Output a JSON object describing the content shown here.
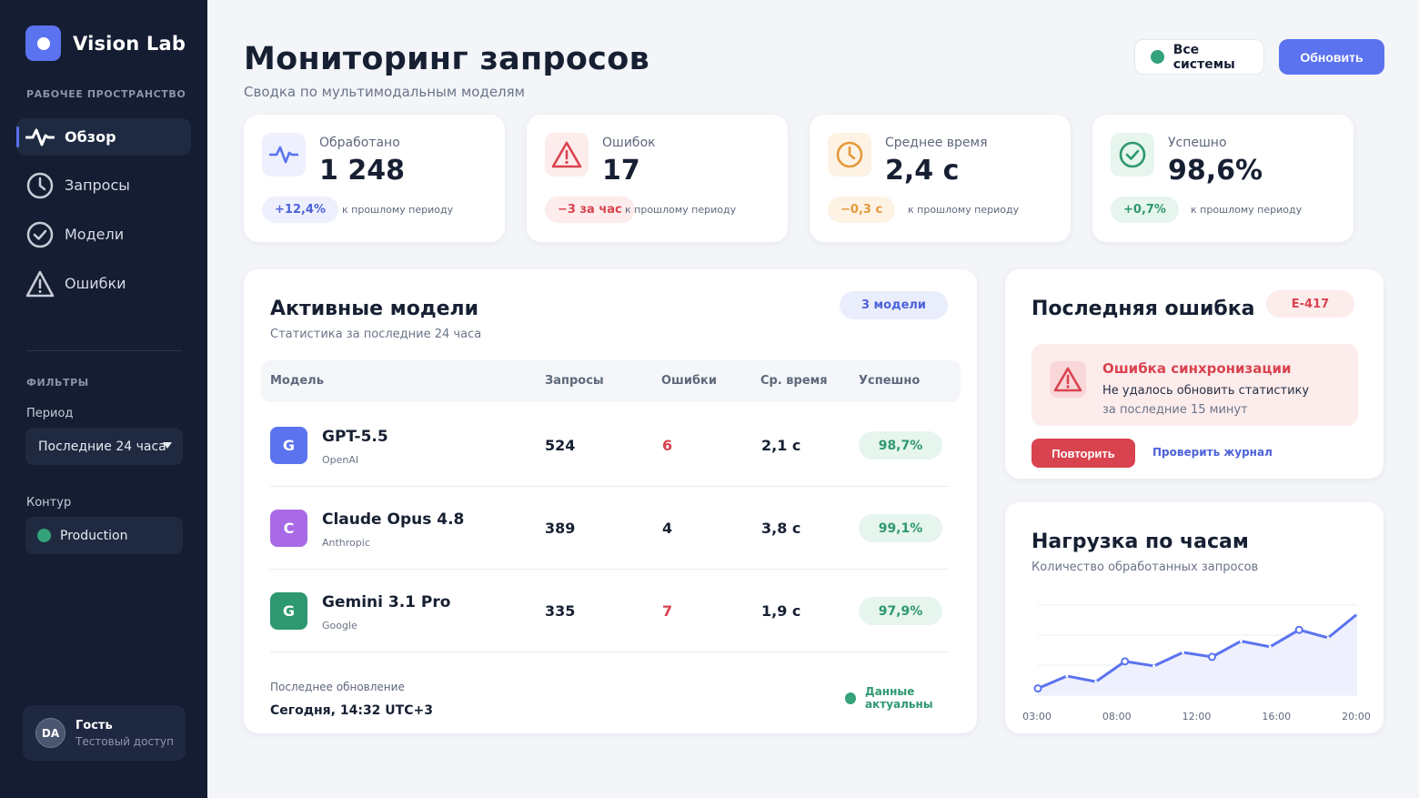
{
  "sidebar": {
    "brand": "Vision Lab",
    "workspace_title": "РАБОЧЕЕ ПРОСТРАНСТВО",
    "nav": [
      {
        "label": "Обзор",
        "icon": "activity-icon",
        "active": true
      },
      {
        "label": "Запросы",
        "icon": "clock-icon",
        "active": false
      },
      {
        "label": "Модели",
        "icon": "check-circle-icon",
        "active": false
      },
      {
        "label": "Ошибки",
        "icon": "warning-icon",
        "active": false
      }
    ],
    "filters_title": "ФИЛЬТРЫ",
    "period_label": "Период",
    "period_value": "Последние 24 часа",
    "contour_label": "Контур",
    "contour_value": "Production",
    "user": {
      "initials": "DA",
      "name": "Гость",
      "role": "Тестовый доступ"
    }
  },
  "header": {
    "title": "Мониторинг запросов",
    "subtitle": "Сводка по мультимодальным моделям",
    "status": "Все системы",
    "refresh": "Обновить"
  },
  "stats": [
    {
      "label": "Обработано",
      "value": "1 248",
      "chip": "+12,4%",
      "note": "к прошлому периоду",
      "icon": "activity-icon",
      "color": "#5b73ef"
    },
    {
      "label": "Ошибок",
      "value": "17",
      "chip": "−3 за час",
      "note": "к прошлому периоду",
      "icon": "warning-icon",
      "color": "#d9434f"
    },
    {
      "label": "Среднее время",
      "value": "2,4 с",
      "chip": "−0,3 с",
      "note": "к прошлому периоду",
      "icon": "clock-icon",
      "color": "#e39a3b"
    },
    {
      "label": "Успешно",
      "value": "98,6%",
      "chip": "+0,7%",
      "note": "к прошлому периоду",
      "icon": "check-circle-icon",
      "color": "#2e9870"
    }
  ],
  "models": {
    "title": "Активные модели",
    "subtitle": "Статистика за последние 24 часа",
    "badge": "3 модели",
    "columns": [
      "Модель",
      "Запросы",
      "Ошибки",
      "Ср. время",
      "Успешно"
    ],
    "rows": [
      {
        "initial": "G",
        "name": "GPT-5.5",
        "vendor": "OpenAI",
        "requests": "524",
        "errors": "6",
        "avg": "2,1 с",
        "success": "98,7%",
        "color": "#5b73ef",
        "error_highlight": true
      },
      {
        "initial": "C",
        "name": "Claude Opus 4.8",
        "vendor": "Anthropic",
        "requests": "389",
        "errors": "4",
        "avg": "3,8 с",
        "success": "99,1%",
        "color": "#a96ae6",
        "error_highlight": false
      },
      {
        "initial": "G",
        "name": "Gemini 3.1 Pro",
        "vendor": "Google",
        "requests": "335",
        "errors": "7",
        "avg": "1,9 с",
        "success": "97,9%",
        "color": "#2e9870",
        "error_highlight": true
      }
    ],
    "updated_label": "Последнее обновление",
    "updated_value": "Сегодня, 14:32 UTC+3",
    "fresh": "Данные актуальны"
  },
  "last_error": {
    "title": "Последняя ошибка",
    "code": "E-417",
    "error_title": "Ошибка синхронизации",
    "error_desc": "Не удалось обновить статистику",
    "error_time": "за последние 15 минут",
    "retry": "Повторить",
    "log_link": "Проверить журнал"
  },
  "load": {
    "title": "Нагрузка по часам",
    "subtitle": "Количество обработанных запросов"
  },
  "chart_data": {
    "type": "area",
    "title": "Нагрузка по часам",
    "subtitle": "Количество обработанных запросов",
    "tick_labels": [
      "03:00",
      "08:00",
      "12:00",
      "16:00",
      "20:00"
    ],
    "values": [
      6,
      17,
      12,
      30,
      26,
      38,
      34,
      48,
      43,
      58,
      51,
      72
    ],
    "markers": [
      0,
      3,
      6,
      9
    ],
    "ylim": [
      0,
      80
    ],
    "grid": true,
    "color": "#5b73ef"
  }
}
